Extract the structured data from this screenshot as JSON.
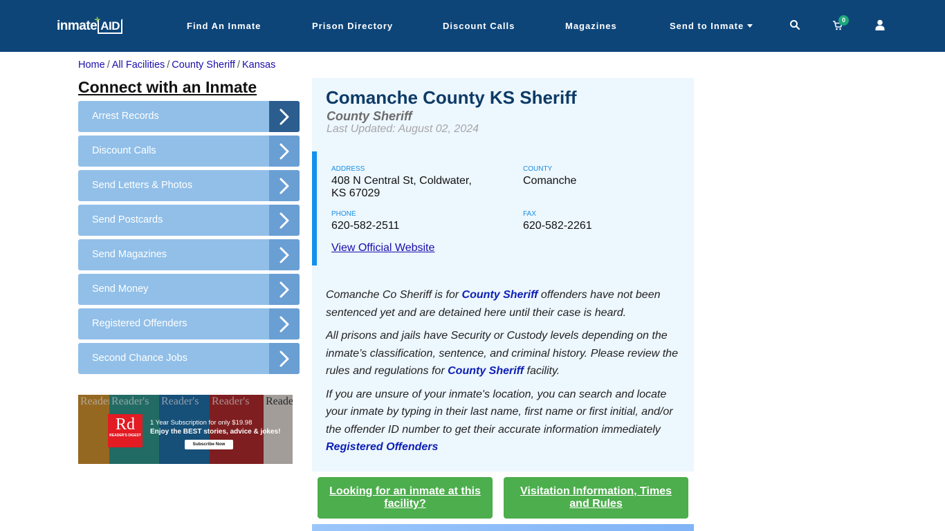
{
  "navbar": {
    "logo_text": "inmate",
    "logo_accent": "AID",
    "items": [
      {
        "label": "Find An Inmate"
      },
      {
        "label": "Prison Directory"
      },
      {
        "label": "Discount Calls"
      },
      {
        "label": "Magazines"
      },
      {
        "label": "Send to Inmate",
        "has_dropdown": true
      }
    ],
    "icons": [
      "search-icon",
      "cart-icon",
      "user-icon"
    ],
    "cart_count": "0",
    "colors": {
      "background": "#0d4579",
      "badge": "#1ca87a"
    }
  },
  "breadcrumb": [
    {
      "label": "Home"
    },
    {
      "label": "All Facilities"
    },
    {
      "label": "County Sheriff"
    },
    {
      "label": "Kansas"
    }
  ],
  "breadcrumb_separator": "/",
  "sidebar": {
    "title": "Connect with an Inmate",
    "items": [
      {
        "label": "Arrest Records"
      },
      {
        "label": "Discount Calls"
      },
      {
        "label": "Send Letters & Photos"
      },
      {
        "label": "Send Postcards"
      },
      {
        "label": "Send Magazines"
      },
      {
        "label": "Send Money"
      },
      {
        "label": "Registered Offenders"
      },
      {
        "label": "Second Chance Jobs"
      }
    ],
    "ad": {
      "brand_short": "Rd",
      "brand_name": "READER'S DIGEST",
      "cover_title": "Reader's",
      "line1": "1 Year Subscription for only $19.98",
      "line2": "Enjoy the BEST stories, advice & jokes!",
      "button": "Subscribe Now"
    }
  },
  "facility": {
    "title": "Comanche County KS Sheriff",
    "type": "County Sheriff",
    "last_updated": "Last Updated: August 02, 2024",
    "address_label": "ADDRESS",
    "address_line1": "408 N Central St, Coldwater,",
    "address_line2": "KS 67029",
    "county_label": "COUNTY",
    "county": "Comanche",
    "phone_label": "PHONE",
    "phone": "620-582-2511",
    "fax_label": "FAX",
    "fax": "620-582-2261",
    "website_link": "View Official Website"
  },
  "description": {
    "p1_a": "Comanche Co Sheriff is for ",
    "p1_link": "County Sheriff",
    "p1_b": " offenders have not been sentenced yet and are detained here until their case is heard.",
    "p2_a": "All prisons and jails have Security or Custody levels depending on the inmate’s classification, sentence, and criminal history. Please review the rules and regulations for ",
    "p2_link": "County Sheriff",
    "p2_b": " facility.",
    "p3": "If you are unsure of your inmate's location, you can search and locate your inmate by typing in their last name, first name or first initial, and/or the offender ID number to get their accurate information immediately",
    "p3_link": "Registered Offenders"
  },
  "actions": {
    "find_inmate": "Looking for an inmate at this facility?",
    "visitation": "Visitation Information, Times and Rules"
  }
}
